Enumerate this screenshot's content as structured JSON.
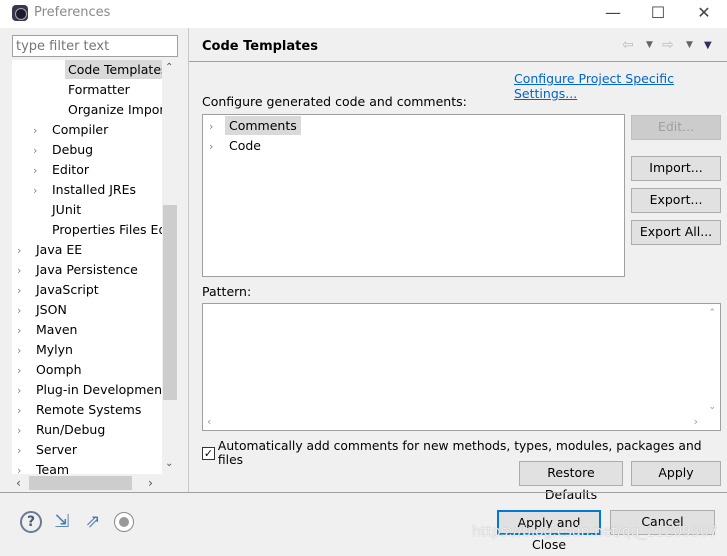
{
  "window": {
    "title": "Preferences",
    "minimize": "—",
    "maximize": "☐",
    "close": "✕"
  },
  "filter": {
    "placeholder": "type filter text"
  },
  "tree": {
    "items": [
      {
        "label": "Code Templates",
        "level": 2,
        "expandable": false,
        "selected": true
      },
      {
        "label": "Formatter",
        "level": 2,
        "expandable": false
      },
      {
        "label": "Organize Imports",
        "level": 2,
        "expandable": false
      },
      {
        "label": "Compiler",
        "level": 1,
        "expandable": true
      },
      {
        "label": "Debug",
        "level": 1,
        "expandable": true
      },
      {
        "label": "Editor",
        "level": 1,
        "expandable": true
      },
      {
        "label": "Installed JREs",
        "level": 1,
        "expandable": true
      },
      {
        "label": "JUnit",
        "level": 1,
        "expandable": false
      },
      {
        "label": "Properties Files Editor",
        "level": 1,
        "expandable": false
      },
      {
        "label": "Java EE",
        "level": 0,
        "expandable": true
      },
      {
        "label": "Java Persistence",
        "level": 0,
        "expandable": true
      },
      {
        "label": "JavaScript",
        "level": 0,
        "expandable": true
      },
      {
        "label": "JSON",
        "level": 0,
        "expandable": true
      },
      {
        "label": "Maven",
        "level": 0,
        "expandable": true
      },
      {
        "label": "Mylyn",
        "level": 0,
        "expandable": true
      },
      {
        "label": "Oomph",
        "level": 0,
        "expandable": true
      },
      {
        "label": "Plug-in Development",
        "level": 0,
        "expandable": true
      },
      {
        "label": "Remote Systems",
        "level": 0,
        "expandable": true
      },
      {
        "label": "Run/Debug",
        "level": 0,
        "expandable": true
      },
      {
        "label": "Server",
        "level": 0,
        "expandable": true
      },
      {
        "label": "Team",
        "level": 0,
        "expandable": true
      }
    ]
  },
  "page": {
    "title": "Code Templates",
    "config_link": "Configure Project Specific Settings...",
    "intro": "Configure generated code and comments:",
    "templates": [
      {
        "label": "Comments",
        "selected": true
      },
      {
        "label": "Code"
      }
    ],
    "buttons": {
      "edit": "Edit...",
      "import": "Import...",
      "export": "Export...",
      "export_all": "Export All..."
    },
    "pattern_label": "Pattern:",
    "pattern_value": "",
    "auto_comments": {
      "label": "Automatically add comments for new methods, types, modules, packages and files",
      "checked": true
    },
    "restore_defaults": "Restore Defaults",
    "apply": "Apply"
  },
  "footer": {
    "apply_close": "Apply and Close",
    "cancel": "Cancel",
    "icons": [
      "help-icon",
      "import-icon",
      "export-icon",
      "record-icon"
    ]
  },
  "watermark": "https://blog.csdn.net/qq_21209307"
}
